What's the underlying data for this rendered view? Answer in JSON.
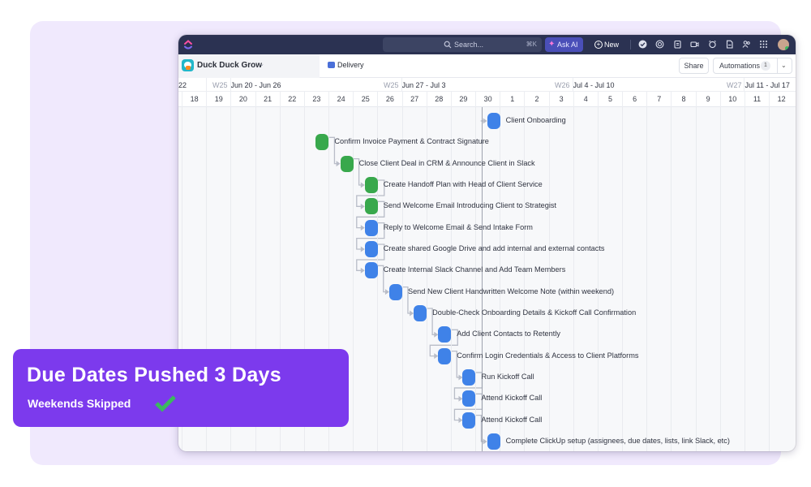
{
  "topbar": {
    "search_placeholder": "Search...",
    "search_shortcut": "⌘K",
    "ask_ai_label": "Ask AI",
    "new_label": "New",
    "icons": [
      "check-circle-icon",
      "record-icon",
      "clipboard-icon",
      "video-icon",
      "alarm-icon",
      "document-icon",
      "people-icon",
      "apps-grid-icon"
    ]
  },
  "toolbar": {
    "space_name": "Duck Duck Grow",
    "view_name": "Delivery",
    "share_label": "Share",
    "automations_label": "Automations",
    "automations_count": "1"
  },
  "timeline": {
    "weeks": [
      {
        "partial_label": "22"
      },
      {
        "week": "W25",
        "range": "Jun 20 - Jun 26"
      },
      {
        "week": "W25",
        "range": "Jun 27 - Jul 3"
      },
      {
        "week": "W26",
        "range": "Jul 4 - Jul 10"
      },
      {
        "week": "W27",
        "range": "Jul 11 - Jul 17"
      }
    ],
    "days": [
      "18",
      "19",
      "20",
      "21",
      "22",
      "23",
      "24",
      "25",
      "26",
      "27",
      "28",
      "29",
      "30",
      "1",
      "2",
      "3",
      "4",
      "5",
      "6",
      "7",
      "8",
      "9",
      "10",
      "11",
      "12"
    ],
    "today_day": "30",
    "tasks": [
      {
        "name": "Client Onboarding",
        "day": "30",
        "status": "blue"
      },
      {
        "name": "Confirm Invoice Payment & Contract Signature",
        "day": "23",
        "status": "green"
      },
      {
        "name": "Close Client Deal in CRM & Announce Client in Slack",
        "day": "24",
        "status": "green"
      },
      {
        "name": "Create Handoff Plan with Head of Client Service",
        "day": "25",
        "status": "green"
      },
      {
        "name": "Send Welcome Email Introducing Client to Strategist",
        "day": "25",
        "status": "green"
      },
      {
        "name": "Reply to Welcome Email & Send Intake Form",
        "day": "25",
        "status": "blue"
      },
      {
        "name": "Create shared Google Drive and add internal and external contacts",
        "day": "25",
        "status": "blue"
      },
      {
        "name": "Create Internal Slack Channel and Add Team Members",
        "day": "25",
        "status": "blue"
      },
      {
        "name": "Send New Client Handwritten Welcome Note (within weekend)",
        "day": "26",
        "status": "blue"
      },
      {
        "name": "Double-Check Onboarding Details & Kickoff Call Confirmation",
        "day": "27",
        "status": "blue"
      },
      {
        "name": "Add Client Contacts to Retently",
        "day": "28",
        "status": "blue"
      },
      {
        "name": "Confirm Login Credentials & Access to Client Platforms",
        "day": "28",
        "status": "blue"
      },
      {
        "name": "Run Kickoff Call",
        "day": "29",
        "status": "blue"
      },
      {
        "name": "Attend Kickoff Call",
        "day": "29",
        "status": "blue"
      },
      {
        "name": "Attend Kickoff Call",
        "day": "29",
        "status": "blue"
      },
      {
        "name": "Complete ClickUp setup (assignees, due dates, lists, link Slack, etc)",
        "day": "30",
        "status": "blue"
      }
    ],
    "colors": {
      "green": "#38a84c",
      "blue": "#3f82e8",
      "link": "#b9bdc8"
    }
  },
  "banner": {
    "title": "Due Dates Pushed 3 Days",
    "subtitle": "Weekends Skipped",
    "check_color": "#3bb85e",
    "background": "#7c3aed"
  }
}
